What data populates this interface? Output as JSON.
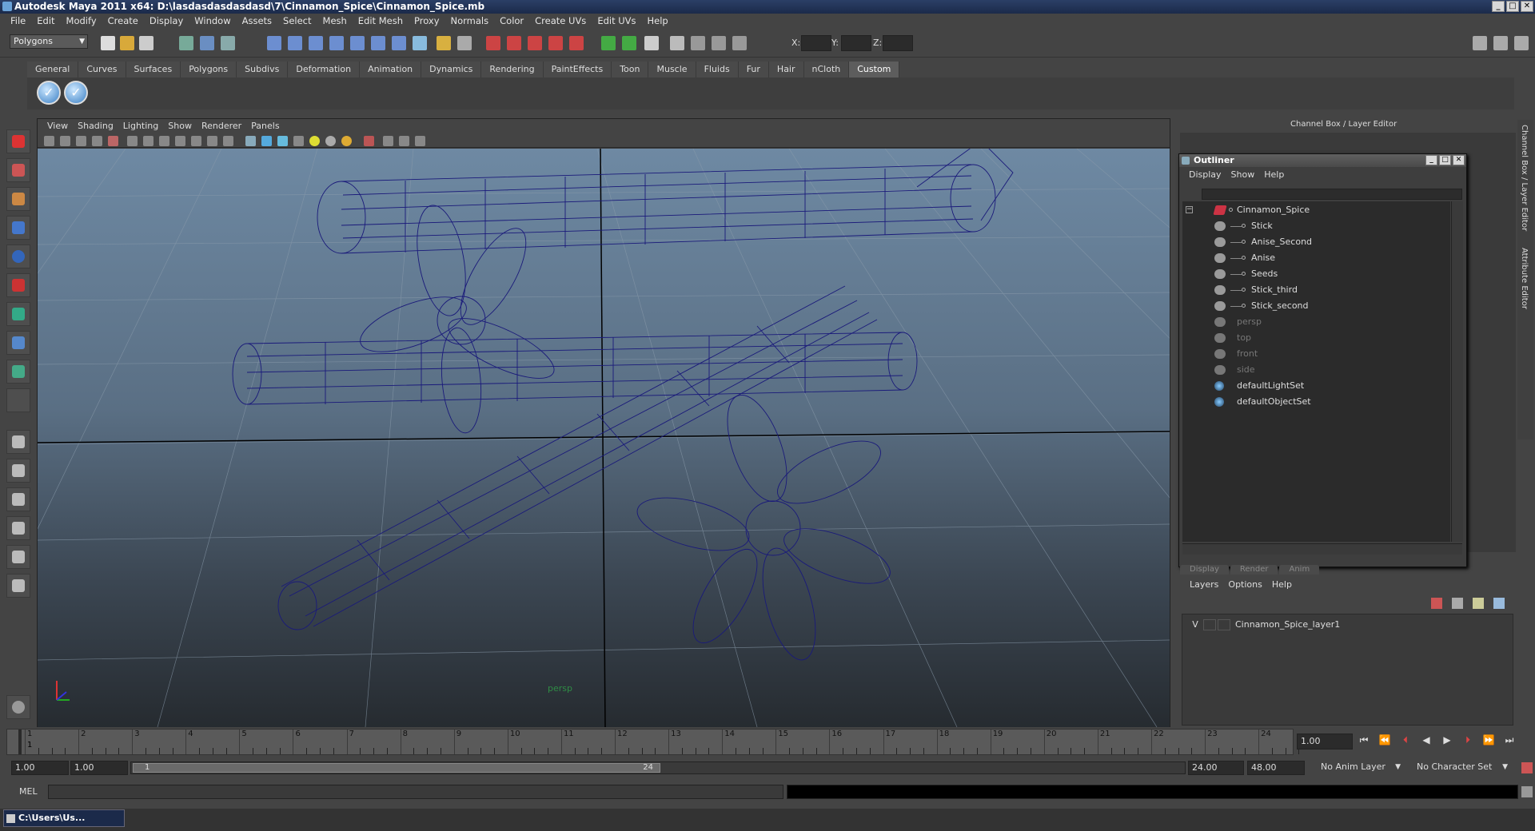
{
  "window": {
    "title": "Autodesk Maya 2011 x64: D:\\lasdasdasdasdasd\\7\\Cinnamon_Spice\\Cinnamon_Spice.mb"
  },
  "menubar": [
    "File",
    "Edit",
    "Modify",
    "Create",
    "Display",
    "Window",
    "Assets",
    "Select",
    "Mesh",
    "Edit Mesh",
    "Proxy",
    "Normals",
    "Color",
    "Create UVs",
    "Edit UVs",
    "Help"
  ],
  "statusline": {
    "mode": "Polygons",
    "x_label": "X:",
    "y_label": "Y:",
    "z_label": "Z:"
  },
  "shelf": {
    "tabs": [
      "General",
      "Curves",
      "Surfaces",
      "Polygons",
      "Subdivs",
      "Deformation",
      "Animation",
      "Dynamics",
      "Rendering",
      "PaintEffects",
      "Toon",
      "Muscle",
      "Fluids",
      "Fur",
      "Hair",
      "nCloth",
      "Custom"
    ],
    "active_tab": "Custom"
  },
  "viewport": {
    "menu": [
      "View",
      "Shading",
      "Lighting",
      "Show",
      "Renderer",
      "Panels"
    ],
    "camera_label": "persp",
    "wire_color": "#1a1a7a"
  },
  "channel_box": {
    "title": "Channel Box / Layer Editor"
  },
  "side_tabs": [
    "Channel Box / Layer Editor",
    "Attribute Editor"
  ],
  "outliner": {
    "title": "Outliner",
    "menu": [
      "Display",
      "Show",
      "Help"
    ],
    "items": [
      {
        "label": "Cinnamon_Spice",
        "icon": "group-icon",
        "level": 0,
        "dim": false
      },
      {
        "label": "Stick",
        "icon": "mesh-icon",
        "level": 1,
        "dim": false
      },
      {
        "label": "Anise_Second",
        "icon": "mesh-icon",
        "level": 1,
        "dim": false
      },
      {
        "label": "Anise",
        "icon": "mesh-icon",
        "level": 1,
        "dim": false
      },
      {
        "label": "Seeds",
        "icon": "mesh-icon",
        "level": 1,
        "dim": false
      },
      {
        "label": "Stick_third",
        "icon": "mesh-icon",
        "level": 1,
        "dim": false
      },
      {
        "label": "Stick_second",
        "icon": "mesh-icon",
        "level": 1,
        "dim": false
      },
      {
        "label": "persp",
        "icon": "camera-icon",
        "level": 0,
        "dim": true
      },
      {
        "label": "top",
        "icon": "camera-icon",
        "level": 0,
        "dim": true
      },
      {
        "label": "front",
        "icon": "camera-icon",
        "level": 0,
        "dim": true
      },
      {
        "label": "side",
        "icon": "camera-icon",
        "level": 0,
        "dim": true
      },
      {
        "label": "defaultLightSet",
        "icon": "set-icon",
        "level": 0,
        "dim": false
      },
      {
        "label": "defaultObjectSet",
        "icon": "set-icon",
        "level": 0,
        "dim": false
      }
    ]
  },
  "layer_editor": {
    "tabs": [
      "Display",
      "Render",
      "Anim"
    ],
    "menu": [
      "Layers",
      "Options",
      "Help"
    ],
    "layers": [
      {
        "visible": "V",
        "name": "Cinnamon_Spice_layer1"
      }
    ]
  },
  "time": {
    "ticks": [
      "1",
      "2",
      "3",
      "4",
      "5",
      "6",
      "7",
      "8",
      "9",
      "10",
      "11",
      "12",
      "13",
      "14",
      "15",
      "16",
      "17",
      "18",
      "19",
      "20",
      "21",
      "22",
      "23",
      "24"
    ],
    "current_frame": "1.00",
    "current_marker": "1",
    "range_start": "1.00",
    "range_inner_start": "1.00",
    "slider_start": "1",
    "slider_end": "24",
    "range_inner_end": "24.00",
    "range_end": "48.00",
    "anim_layer": "No Anim Layer",
    "character_set": "No Character Set"
  },
  "command_line": {
    "label": "MEL"
  },
  "taskbar": {
    "item": "C:\\Users\\Us..."
  }
}
